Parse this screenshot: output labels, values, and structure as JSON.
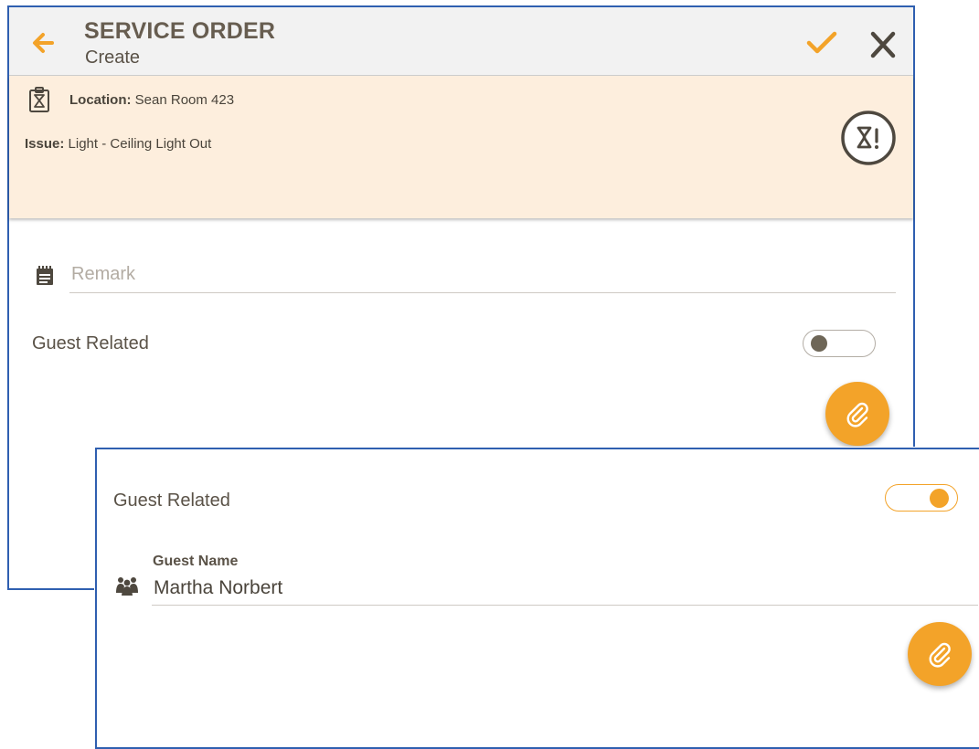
{
  "header": {
    "title": "SERVICE ORDER",
    "subtitle": "Create"
  },
  "info": {
    "location_label": "Location:",
    "location_value": "Sean Room 423",
    "issue_label": "Issue:",
    "issue_value": "Light - Ceiling Light Out"
  },
  "form": {
    "remark_placeholder": "Remark",
    "remark_value": "",
    "guest_related_label": "Guest Related",
    "guest_related_on": false
  },
  "form_expanded": {
    "guest_related_label": "Guest Related",
    "guest_related_on": true,
    "guest_name_label": "Guest Name",
    "guest_name_value": "Martha Norbert"
  },
  "icons": {
    "back": "arrow-left-icon",
    "save": "checkmark-icon",
    "close": "close-icon",
    "location": "hourglass-clipboard-icon",
    "issue_badge": "hourglass-alert-icon",
    "remark": "notepad-icon",
    "guest": "people-group-icon",
    "attach": "paperclip-icon"
  },
  "colors": {
    "accent": "#f3a329",
    "info_bg": "#fdeedd",
    "header_bg": "#f2f2f2",
    "text": "#5a5247",
    "frame_border": "#2f5fb0"
  }
}
